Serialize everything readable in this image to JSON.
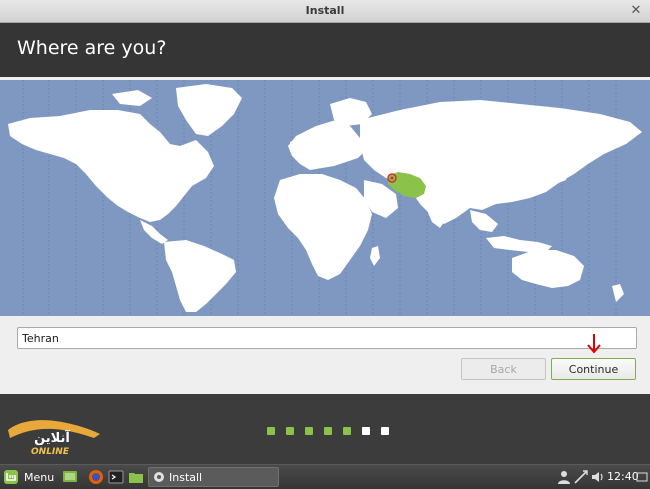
{
  "window": {
    "title": "Install"
  },
  "page": {
    "heading": "Where are you?"
  },
  "timezone": {
    "value": "Tehran",
    "selected_region": "Iran"
  },
  "buttons": {
    "back": "Back",
    "continue": "Continue"
  },
  "progress": {
    "total_steps": 7,
    "completed_steps": 5,
    "done_color": "#8bc34a",
    "pending_color": "#ffffff"
  },
  "logo": {
    "text_fa": "آنلاین",
    "text_en": "ONLINE"
  },
  "taskbar": {
    "menu_label": "Menu",
    "task_label": "Install",
    "clock": "12:40"
  },
  "colors": {
    "ocean": "#7f98c2",
    "land": "#ffffff",
    "selected_land": "#8bc34a",
    "accent": "#8bc34a"
  }
}
